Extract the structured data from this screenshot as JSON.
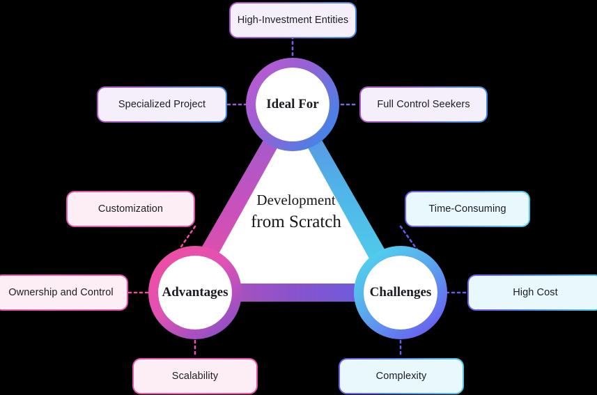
{
  "background_color": "#000000",
  "center": {
    "line1": "Development",
    "line2": "from Scratch"
  },
  "nodes": [
    {
      "id": "ideal-for",
      "label": "Ideal For",
      "ring_start": "#b45ad0",
      "ring_end": "#3f86e8"
    },
    {
      "id": "advantages",
      "label": "Advantages",
      "ring_start": "#ef4da0",
      "ring_end": "#8a4fc8"
    },
    {
      "id": "challenges",
      "label": "Challenges",
      "ring_start": "#4fd4ec",
      "ring_end": "#6a5cf0"
    }
  ],
  "labels": [
    {
      "id": "high-investment-entities",
      "text": "High-Investment Entities",
      "group": "ideal"
    },
    {
      "id": "specialized-project",
      "text": "Specialized Project",
      "group": "ideal"
    },
    {
      "id": "full-control-seekers",
      "text": "Full Control Seekers",
      "group": "ideal"
    },
    {
      "id": "customization",
      "text": "Customization",
      "group": "advantages"
    },
    {
      "id": "ownership-and-control",
      "text": "Ownership and Control",
      "group": "advantages"
    },
    {
      "id": "scalability",
      "text": "Scalability",
      "group": "advantages"
    },
    {
      "id": "time-consuming",
      "text": "Time-Consuming",
      "group": "challenges"
    },
    {
      "id": "high-cost",
      "text": "High Cost",
      "group": "challenges"
    },
    {
      "id": "complexity",
      "text": "Complexity",
      "group": "challenges"
    }
  ],
  "colors": {
    "ideal_fill": "#f5effb",
    "advantages_fill": "#fdeef6",
    "challenges_fill": "#e8f8fd",
    "triangle_fill": "#ffffff",
    "text_dark": "#1c1c22"
  }
}
